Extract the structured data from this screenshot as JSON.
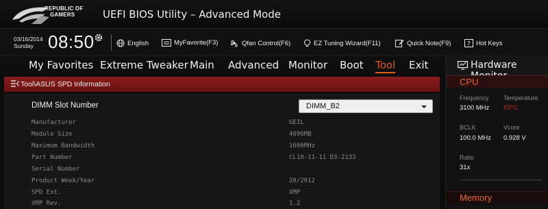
{
  "title_bar": {
    "logo_line1": "REPUBLIC OF",
    "logo_line2": "GAMERS",
    "app_title": "UEFI BIOS Utility – Advanced Mode"
  },
  "info_bar": {
    "date": "03/16/2014",
    "day": "Sunday",
    "time": "08:50",
    "tools": [
      {
        "label": "English",
        "icon": "globe-icon"
      },
      {
        "label": "MyFavorite(F3)",
        "icon": "favorite-icon"
      },
      {
        "label": "Qfan Control(F6)",
        "icon": "fan-icon"
      },
      {
        "label": "EZ Tuning Wizard(F11)",
        "icon": "bulb-icon"
      },
      {
        "label": "Quick Note(F9)",
        "icon": "note-icon"
      },
      {
        "label": "Hot Keys",
        "icon": "hotkeys-icon"
      }
    ]
  },
  "nav": {
    "tabs": [
      "My Favorites",
      "Extreme Tweaker",
      "Main",
      "Advanced",
      "Monitor",
      "Boot",
      "Tool",
      "Exit"
    ],
    "active": "Tool"
  },
  "breadcrumb": "Tool\\ASUS SPD Information",
  "dimm_slot": {
    "label": "DIMM Slot Number",
    "selected": "DIMM_B2"
  },
  "spd_rows": [
    {
      "label": "Manufacturer",
      "value": "GEIL"
    },
    {
      "label": "Module Size",
      "value": "4096MB"
    },
    {
      "label": "Maximum Bandwidth",
      "value": "1600MHz"
    },
    {
      "label": "Part Number",
      "value": "CL10-11-11 D3-2133"
    },
    {
      "label": "Serial Number",
      "value": ""
    },
    {
      "label": "Product Week/Year",
      "value": "20/2012"
    },
    {
      "label": "SPD Ext.",
      "value": "XMP"
    },
    {
      "label": "XMP Rev.",
      "value": "1.2"
    }
  ],
  "hardware_monitor": {
    "title": "Hardware Monitor",
    "cpu": {
      "section": "CPU",
      "frequency_label": "Frequency",
      "frequency": "3100 MHz",
      "temperature_label": "Temperature",
      "temperature": "83°C",
      "bclk_label": "BCLK",
      "bclk": "100.0 MHz",
      "vcore_label": "Vcore",
      "vcore": "0.928 V",
      "ratio_label": "Ratio",
      "ratio": "31x"
    },
    "memory": {
      "section": "Memory"
    }
  },
  "colors": {
    "accent": "#e05a1a",
    "breadcrumb_bg": "#7a1818",
    "warn_temp": "#b42a2a"
  }
}
